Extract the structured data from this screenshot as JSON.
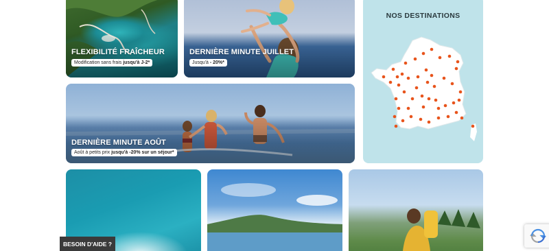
{
  "cards": [
    {
      "title": "Flexibilité fraîcheur",
      "chip_text": "Modification sans frais ",
      "chip_bold": "jusqu'à J-2*"
    },
    {
      "title": "Dernière minute juillet",
      "chip_text": "Jusqu'à ",
      "chip_bold": "- 20%*"
    },
    {
      "title": "Dernière minute août",
      "chip_text": "Août à petits prix ",
      "chip_bold": "jusqu'à -20% sur un séjour*"
    }
  ],
  "destinations": {
    "title": "NOS DESTINATIONS",
    "map_fill": "#ffffff",
    "marker_color": "#e8541c",
    "background": "#bfe3ea"
  },
  "help": {
    "label": "BESOIN D'AIDE ?"
  },
  "recaptcha": {
    "icon": "recaptcha-icon"
  }
}
